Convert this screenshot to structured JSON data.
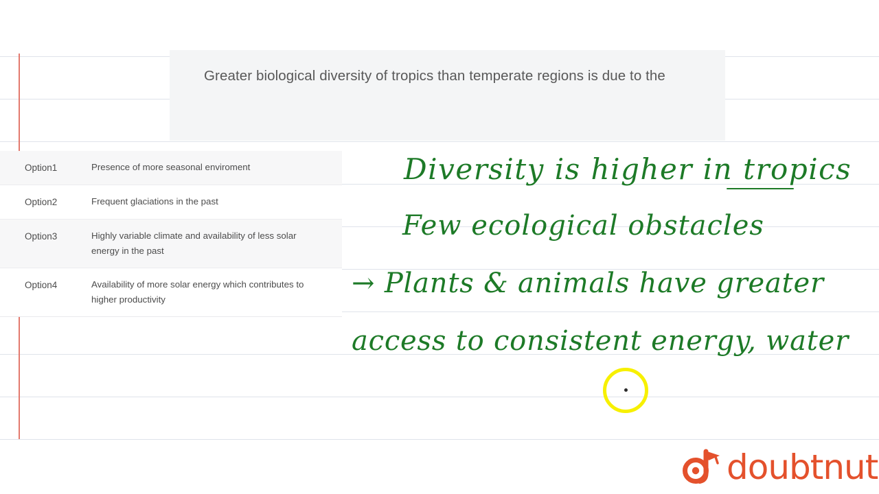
{
  "question": {
    "text": "Greater biological diversity of tropics than temperate regions is due to the"
  },
  "options": [
    {
      "key": "Option1",
      "value": "Presence of more seasonal enviroment"
    },
    {
      "key": "Option2",
      "value": "Frequent glaciations in the past"
    },
    {
      "key": "Option3",
      "value": "Highly variable climate and availability of less solar energy in the past"
    },
    {
      "key": "Option4",
      "value": "Availability of more solar energy which contributes to higher productivity"
    }
  ],
  "handwriting": {
    "line1": "Diversity is higher in tropics",
    "line2": "Few ecological obstacles",
    "line3": "→ Plants & animals have greater",
    "line4": "access to consistent energy, water"
  },
  "logo": {
    "wordmark": "doubtnut",
    "mark_icon": "doubtnut-d-graduation-cap-icon",
    "color": "#e4512c"
  },
  "cursor": {
    "icon": "cursor-ring-highlight-icon",
    "color": "#f7f000"
  },
  "paper": {
    "rule_color": "#dfe3ea",
    "margin_color": "#e3796e",
    "ink_color": "#1d7a27"
  }
}
